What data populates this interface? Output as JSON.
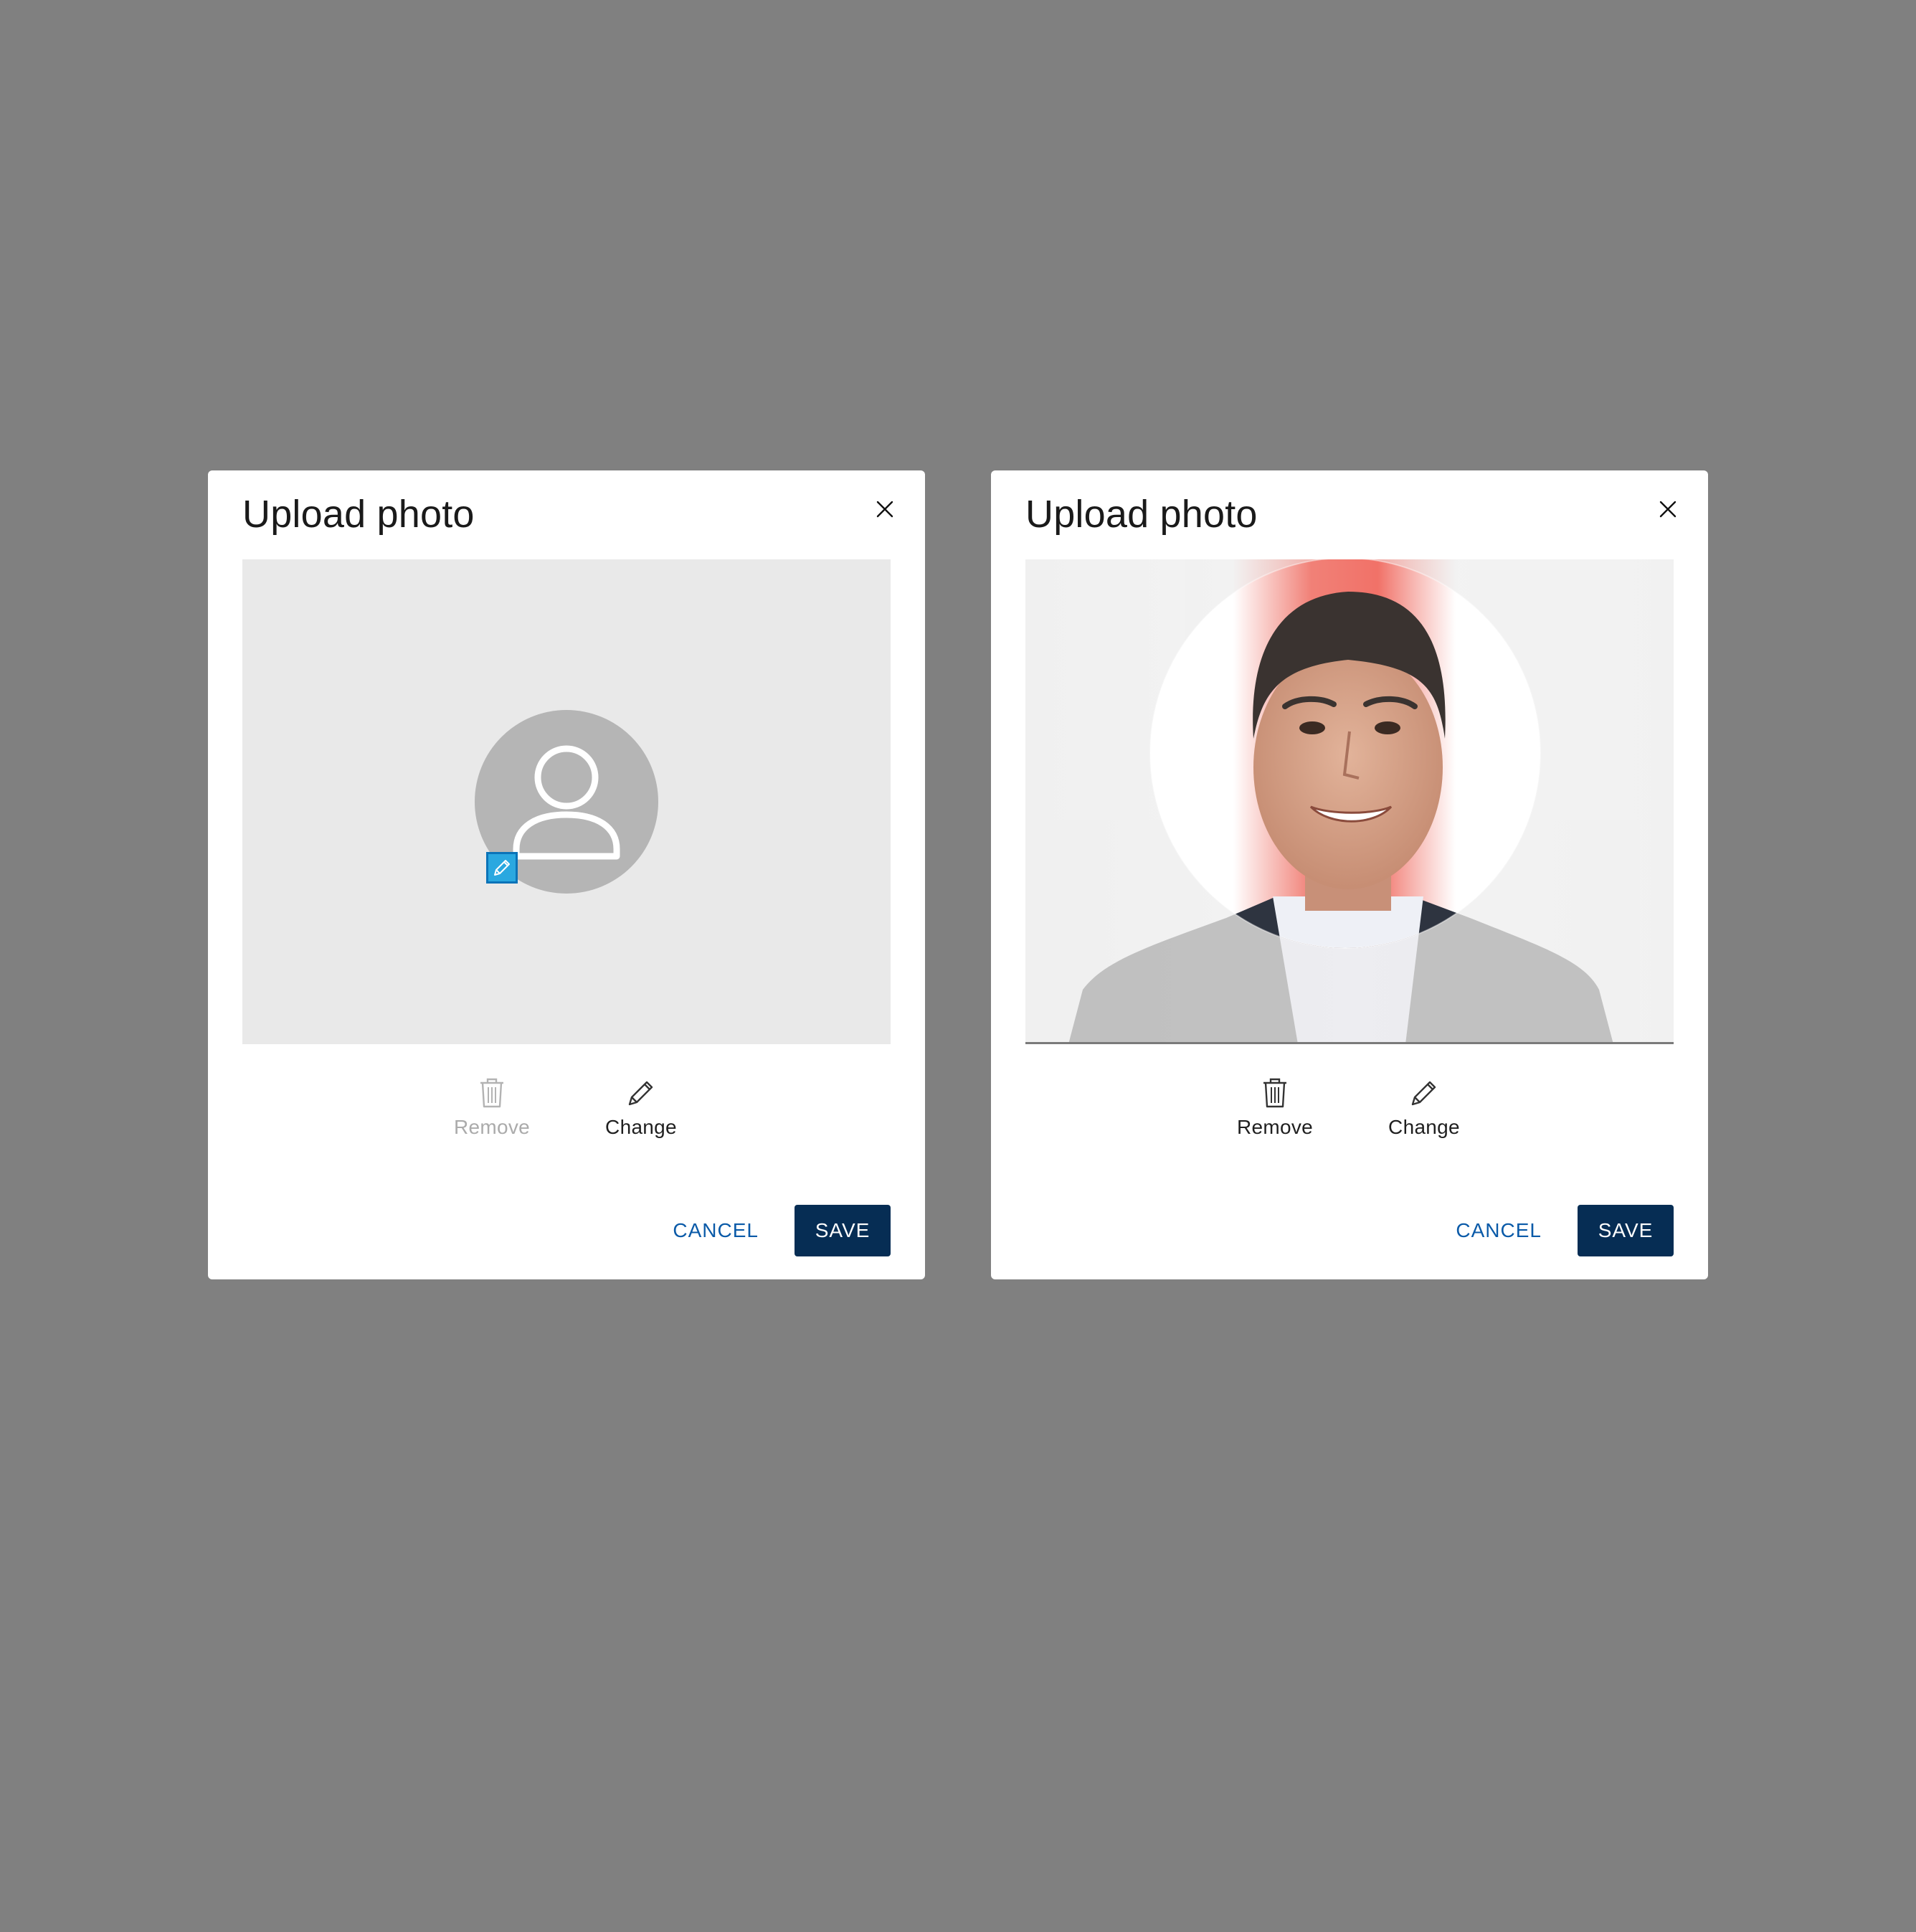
{
  "dialogs": [
    {
      "title": "Upload photo",
      "state": "empty",
      "remove_label": "Remove",
      "remove_disabled": true,
      "change_label": "Change",
      "cancel_label": "CANCEL",
      "save_label": "SAVE"
    },
    {
      "title": "Upload photo",
      "state": "photo",
      "remove_label": "Remove",
      "remove_disabled": false,
      "change_label": "Change",
      "cancel_label": "CANCEL",
      "save_label": "SAVE"
    }
  ],
  "icons": {
    "close": "close-icon",
    "placeholder": "user-icon",
    "badge": "pencil-icon",
    "remove": "trash-icon",
    "change": "pencil-icon"
  },
  "colors": {
    "backdrop": "#808080",
    "dialog_bg": "#ffffff",
    "primary_button": "#062d54",
    "link_text": "#0a5aa8",
    "placeholder_bg": "#e9e9e9",
    "avatar_bg": "#b5b5b5",
    "badge": "#2aa8e0",
    "disabled_text": "#ababab"
  }
}
